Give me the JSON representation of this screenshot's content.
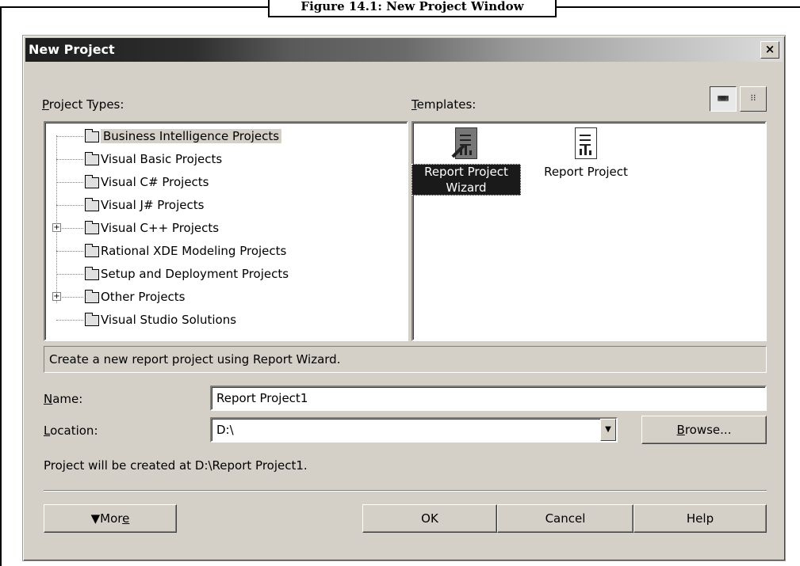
{
  "caption": "Figure 14.1: New Project Window",
  "window": {
    "title": "New Project",
    "close_label": "×"
  },
  "project_types": {
    "label_ul": "P",
    "label_rest": "roject Types:",
    "items": [
      {
        "label": "Business Intelligence Projects",
        "selected": true,
        "expandable": false
      },
      {
        "label": "Visual Basic Projects",
        "expandable": false
      },
      {
        "label": "Visual C# Projects",
        "expandable": false
      },
      {
        "label": "Visual J# Projects",
        "expandable": false
      },
      {
        "label": "Visual C++ Projects",
        "expandable": true
      },
      {
        "label": "Rational XDE Modeling Projects",
        "expandable": false
      },
      {
        "label": "Setup and Deployment Projects",
        "expandable": false
      },
      {
        "label": "Other Projects",
        "expandable": true
      },
      {
        "label": "Visual Studio Solutions",
        "expandable": false
      }
    ],
    "expand_glyph": "+"
  },
  "templates": {
    "label_ul": "T",
    "label_rest": "emplates:",
    "large_icons_glyph": "▦▦",
    "small_icons_glyph": "⁝⁝",
    "items": [
      {
        "line1": "Report Project",
        "line2": "Wizard",
        "selected": true,
        "icon": "report-wizard-icon"
      },
      {
        "line1": "Report Project",
        "line2": "",
        "selected": false,
        "icon": "report-project-icon"
      }
    ]
  },
  "description": "Create a new report project using Report Wizard.",
  "name_field": {
    "label_ul": "N",
    "label_rest": "ame:",
    "value": "Report Project1"
  },
  "location_field": {
    "label_ul": "L",
    "label_rest": "ocation:",
    "value": "D:\\",
    "dropdown_glyph": "▼"
  },
  "browse_button": {
    "label_ul": "B",
    "label_rest": "rowse..."
  },
  "path_info": "Project will be created at D:\\Report Project1.",
  "buttons": {
    "more_prefix": "▼Mor",
    "more_ul": "e",
    "ok": "OK",
    "cancel": "Cancel",
    "help": "Help"
  }
}
